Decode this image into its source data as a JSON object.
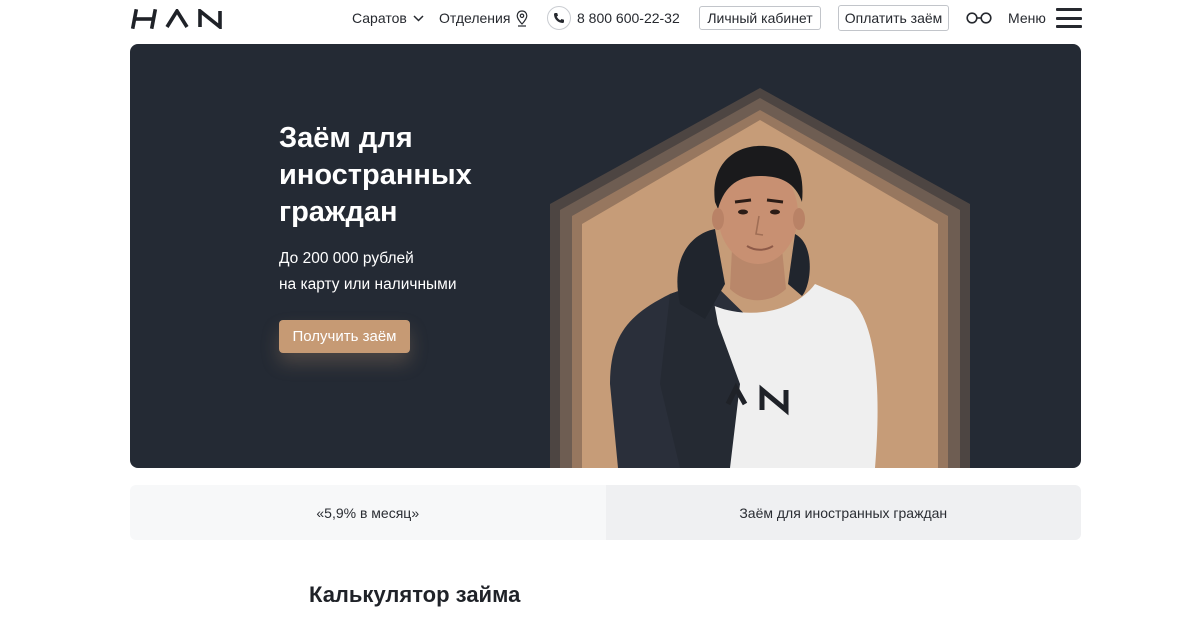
{
  "header": {
    "logo_icon": "han-logo-icon",
    "city": "Саратов",
    "offices": "Отделения",
    "phone": "8 800 600-22-32",
    "cabinet_label": "Личный кабинет",
    "pay_label": "Оплатить заём",
    "accessibility_icon": "glasses-icon",
    "menu_label": "Меню"
  },
  "hero": {
    "title": "Заём для иностранных граждан",
    "subtitle_line1": "До 200 000 рублей",
    "subtitle_line2": "на карту или наличными",
    "cta_label": "Получить заём",
    "image": "young-man-in-branded-sweatshirt-in-hexagon"
  },
  "tabs": [
    {
      "label": "«5,9% в месяц»",
      "active": false
    },
    {
      "label": "Заём для иностранных граждан",
      "active": true
    }
  ],
  "calculator": {
    "title": "Калькулятор займа"
  },
  "colors": {
    "hero_bg": "#242a34",
    "accent": "#c69a74",
    "text": "#1f2228"
  }
}
